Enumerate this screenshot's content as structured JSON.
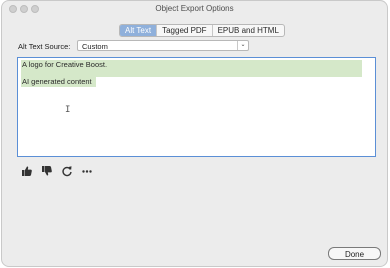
{
  "window": {
    "title": "Object Export Options"
  },
  "tabs": [
    {
      "label": "Alt Text",
      "active": true
    },
    {
      "label": "Tagged PDF",
      "active": false
    },
    {
      "label": "EPUB and HTML",
      "active": false
    }
  ],
  "alt_text_source": {
    "label": "Alt Text Source:",
    "value": "Custom"
  },
  "text_area": {
    "lines": [
      "A logo for Creative Boost.",
      "AI generated content"
    ],
    "highlight_color": "#d5e8c9"
  },
  "feedback_icons": [
    "thumbs-up-icon",
    "thumbs-down-icon",
    "refresh-icon",
    "more-icon"
  ],
  "footer": {
    "done_label": "Done"
  },
  "colors": {
    "active_tab": "#8fb0db",
    "focus_border": "#5b8fd6"
  }
}
